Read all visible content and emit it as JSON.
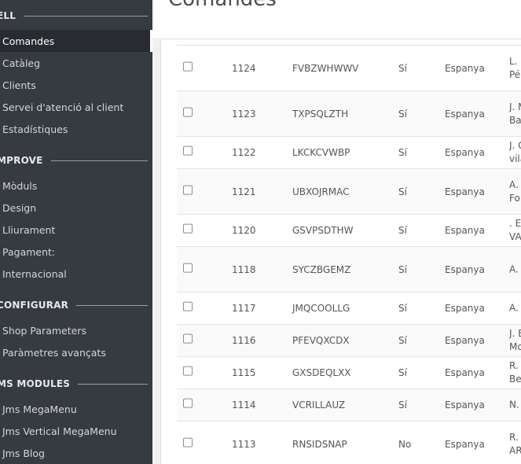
{
  "sidebar": {
    "sections": [
      {
        "title": "ELL",
        "items": [
          {
            "label": "Comandes",
            "active": true
          },
          {
            "label": "Catàleg"
          },
          {
            "label": "Clients"
          },
          {
            "label": "Servei d'atenció al client"
          },
          {
            "label": "Estadístiques"
          }
        ]
      },
      {
        "title": "MPROVE",
        "items": [
          {
            "label": "Mòduls"
          },
          {
            "label": "Design"
          },
          {
            "label": "Lliurament"
          },
          {
            "label": "Pagament:"
          },
          {
            "label": "Internacional"
          }
        ]
      },
      {
        "title": "CONFIGURAR",
        "items": [
          {
            "label": "Shop Parameters"
          },
          {
            "label": "Paràmetres avançats"
          }
        ]
      },
      {
        "title": "MS MODULES",
        "items": [
          {
            "label": "Jms MegaMenu"
          },
          {
            "label": "Jms Vertical MegaMenu"
          },
          {
            "label": "Jms Blog"
          }
        ]
      }
    ]
  },
  "header": {
    "title": "Comandes"
  },
  "orders": [
    {
      "id": "1124",
      "reference": "FVBZWHWWV",
      "new_client": "Sí",
      "country": "Espanya",
      "customer": [
        "L. F",
        "Pé"
      ]
    },
    {
      "id": "1123",
      "reference": "TXPSQLZTH",
      "new_client": "Sí",
      "country": "Espanya",
      "customer": [
        "J. M",
        "Ba"
      ]
    },
    {
      "id": "1122",
      "reference": "LKCKCVWBP",
      "new_client": "Sí",
      "country": "Espanya",
      "customer": [
        "J. G",
        "vila"
      ]
    },
    {
      "id": "1121",
      "reference": "UBXOJRMAC",
      "new_client": "Sí",
      "country": "Espanya",
      "customer": [
        "A.",
        "For"
      ]
    },
    {
      "id": "1120",
      "reference": "GSVPSDTHW",
      "new_client": "Sí",
      "country": "Espanya",
      "customer": [
        ". El",
        "VA"
      ]
    },
    {
      "id": "1118",
      "reference": "SYCZBGEMZ",
      "new_client": "Sí",
      "country": "Espanya",
      "customer": [
        "A. V"
      ]
    },
    {
      "id": "1117",
      "reference": "JMQCOOLLG",
      "new_client": "Sí",
      "country": "Espanya",
      "customer": [
        "A. C"
      ]
    },
    {
      "id": "1116",
      "reference": "PFEVQXCDX",
      "new_client": "Sí",
      "country": "Espanya",
      "customer": [
        "J. E",
        "Mo"
      ]
    },
    {
      "id": "1115",
      "reference": "GXSDEQLXX",
      "new_client": "Sí",
      "country": "Espanya",
      "customer": [
        "R.",
        "Be"
      ]
    },
    {
      "id": "1114",
      "reference": "VCRILLAUZ",
      "new_client": "Sí",
      "country": "Espanya",
      "customer": [
        "N."
      ]
    },
    {
      "id": "1113",
      "reference": "RNSIDSNAP",
      "new_client": "No",
      "country": "Espanya",
      "customer": [
        "R.",
        "AR"
      ]
    }
  ]
}
